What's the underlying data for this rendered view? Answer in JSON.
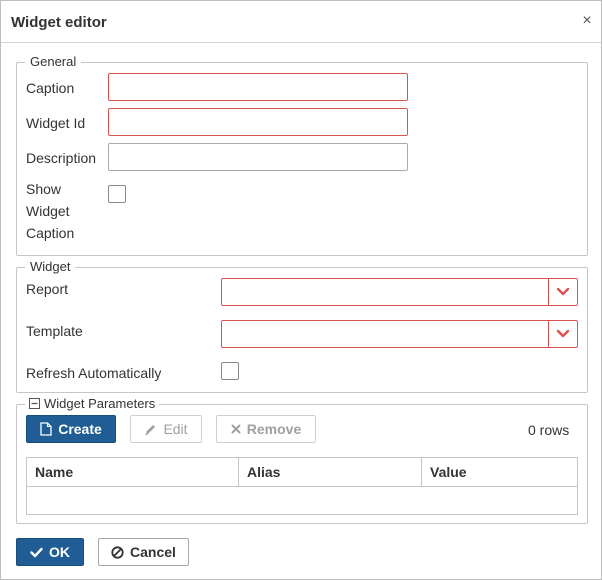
{
  "dialog": {
    "title": "Widget editor",
    "close_symbol": "×"
  },
  "general": {
    "legend": "General",
    "caption_label": "Caption",
    "caption_value": "",
    "widget_id_label": "Widget Id",
    "widget_id_value": "",
    "description_label": "Description",
    "description_value": "",
    "show_caption_label_1": "Show",
    "show_caption_label_2": "Widget",
    "show_caption_label_3": "Caption",
    "show_caption_checked": false
  },
  "widget": {
    "legend": "Widget",
    "report_label": "Report",
    "report_value": "",
    "template_label": "Template",
    "template_value": "",
    "refresh_label": "Refresh Automatically",
    "refresh_checked": false
  },
  "parameters": {
    "legend": "Widget Parameters",
    "create_label": "Create",
    "edit_label": "Edit",
    "remove_label": "Remove",
    "row_count": "0 rows",
    "columns": [
      "Name",
      "Alias",
      "Value"
    ],
    "rows": []
  },
  "footer": {
    "ok_label": "OK",
    "cancel_label": "Cancel"
  },
  "colors": {
    "primary": "#1f5d94",
    "required_border": "#d9534f",
    "border": "#c6c6c6"
  },
  "icons": {
    "close": "close-icon",
    "chevron": "chevron-down-icon",
    "collapse": "minus-square-icon",
    "create": "file-icon",
    "edit": "pencil-icon",
    "remove": "x-icon",
    "ok": "check-icon",
    "cancel": "ban-icon"
  }
}
